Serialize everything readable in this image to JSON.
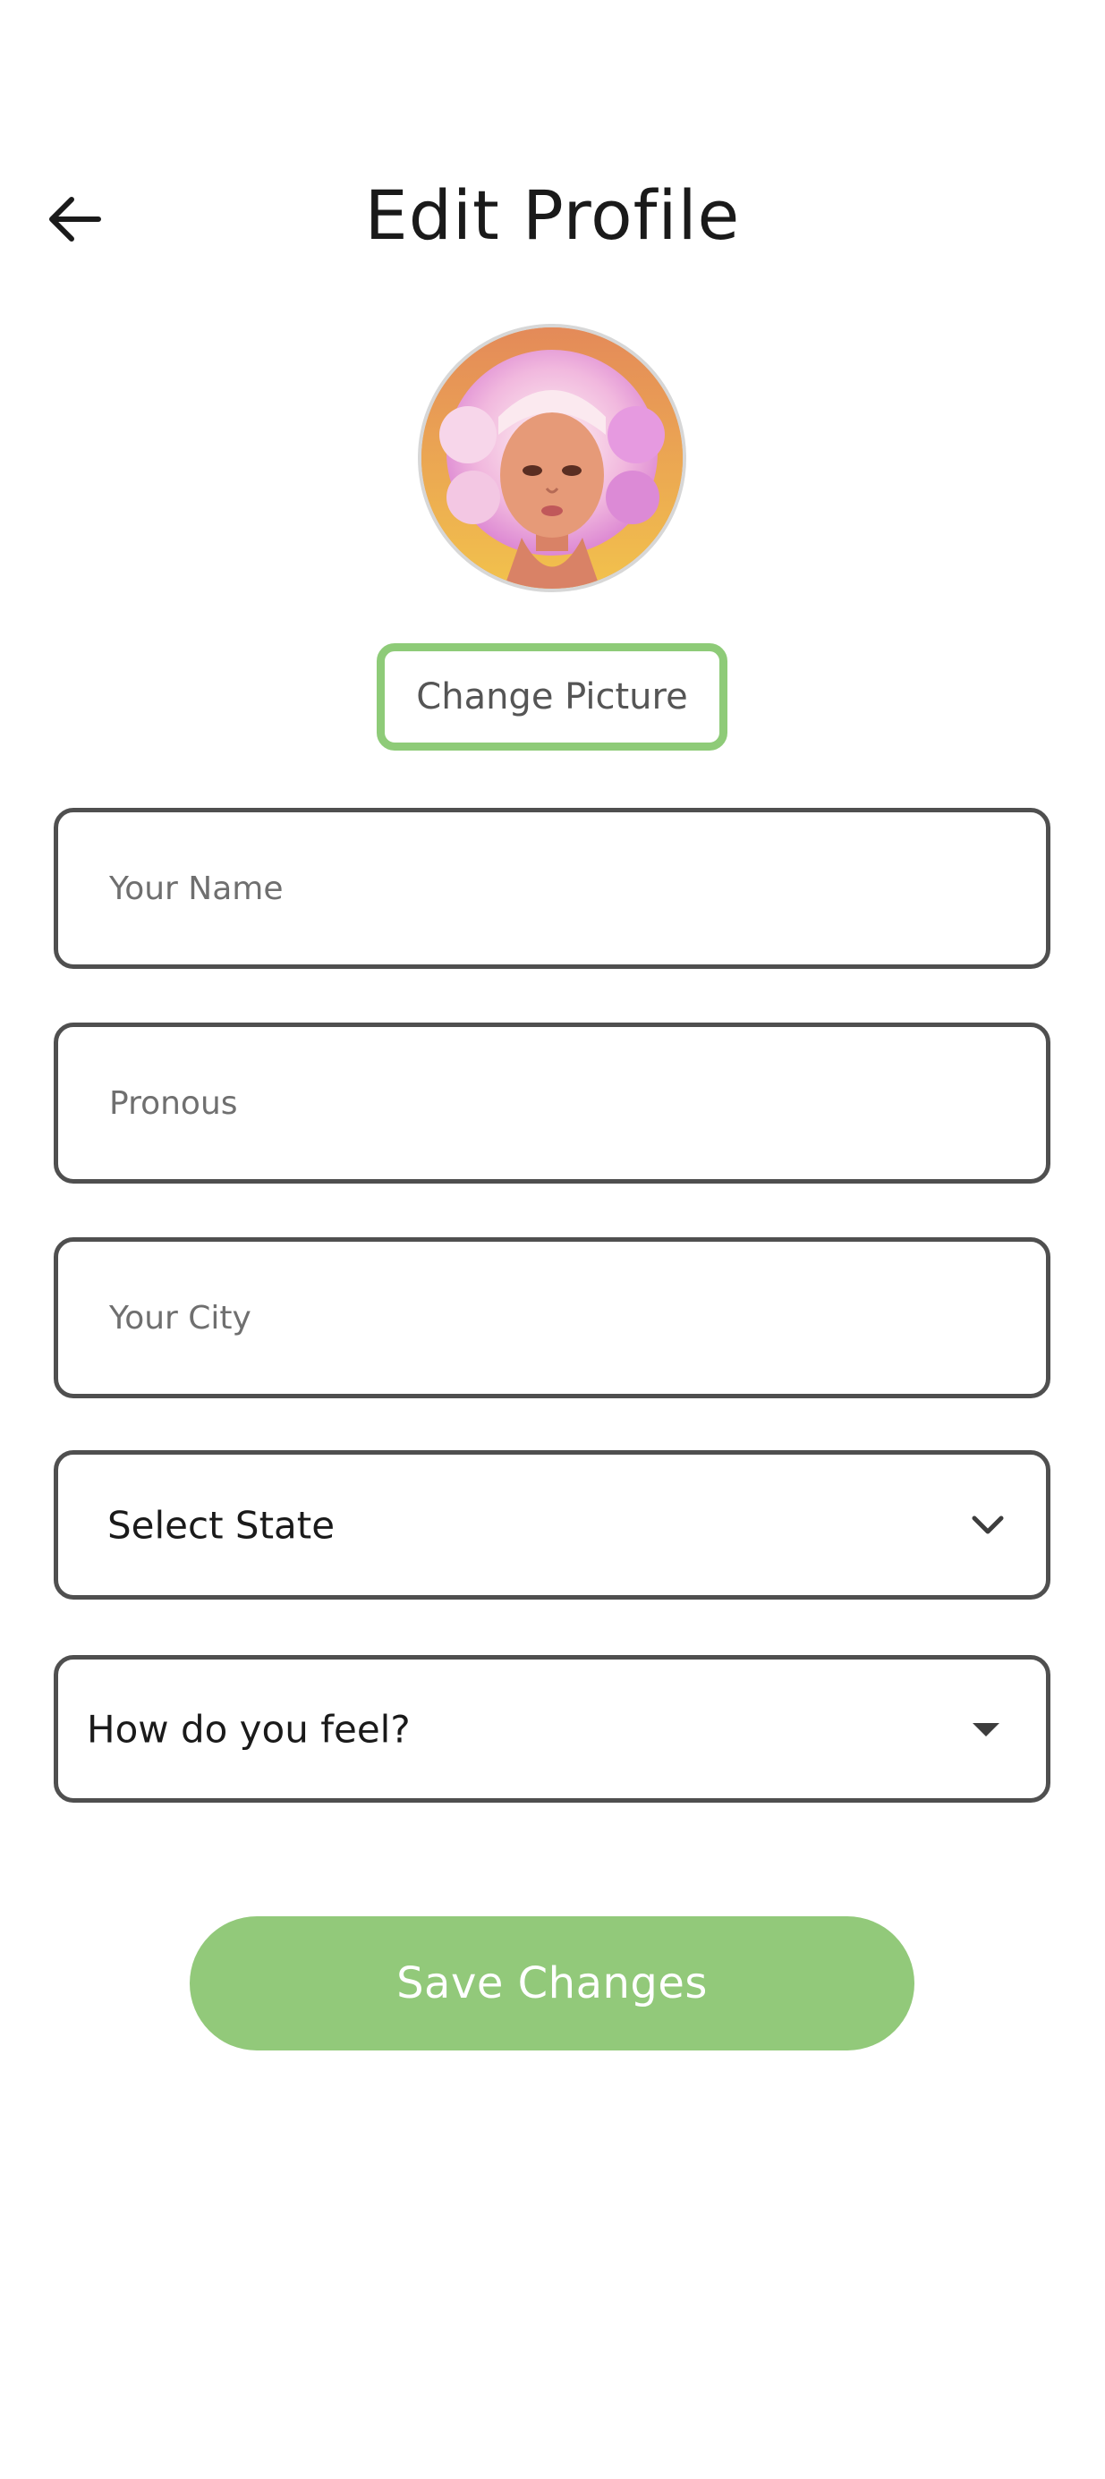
{
  "header": {
    "title": "Edit Profile",
    "back_icon": "arrow-left-icon"
  },
  "avatar": {
    "icon": "profile-avatar"
  },
  "change_picture": {
    "label": "Change Picture"
  },
  "fields": {
    "name": {
      "placeholder": "Your Name",
      "value": ""
    },
    "pronouns": {
      "placeholder": "Pronous",
      "value": ""
    },
    "city": {
      "placeholder": "Your City",
      "value": ""
    }
  },
  "state_select": {
    "value": "Select State",
    "icon": "chevron-down-icon"
  },
  "feel_select": {
    "value": "How do you feel?",
    "icon": "caret-down-icon"
  },
  "save": {
    "label": "Save Changes"
  },
  "colors": {
    "accent": "#92c97a",
    "accent_border": "#8ecb78",
    "field_border": "#4f4f4f"
  }
}
